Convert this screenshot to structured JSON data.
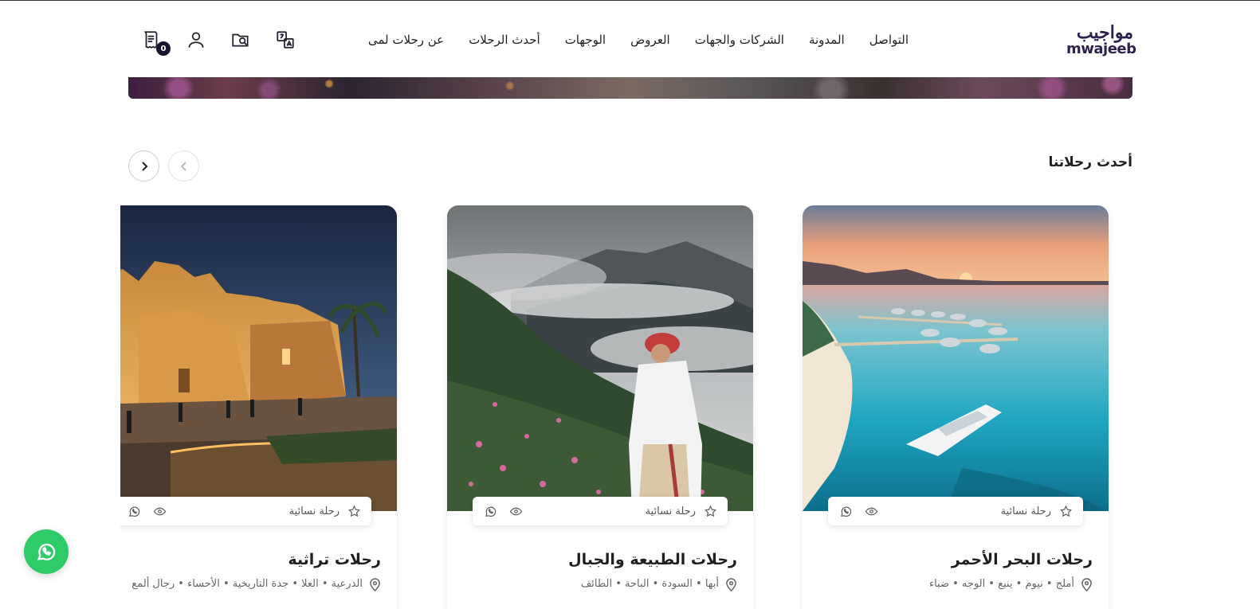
{
  "brand": {
    "name_ar": "مواجيب",
    "name_en": "mwajeeb"
  },
  "nav": {
    "items": [
      {
        "label": "عن رحلات لمى"
      },
      {
        "label": "أحدث الرحلات"
      },
      {
        "label": "الوجهات"
      },
      {
        "label": "العروض"
      },
      {
        "label": "الشركات والجهات"
      },
      {
        "label": "المدونة"
      },
      {
        "label": "التواصل"
      }
    ]
  },
  "header_icons": {
    "cart_count": "0",
    "icons": [
      "translate-icon",
      "search-icon",
      "user-icon",
      "cart-icon"
    ]
  },
  "section": {
    "title": "أحدث رحلاتنا"
  },
  "cards": [
    {
      "title": "رحلات البحر الأحمر",
      "tag": "رحلة نسائية",
      "locations": "أملج • نيوم • ينبع • الوجه • ضباء",
      "image": "red-sea-yacht"
    },
    {
      "title": "رحلات الطبيعة والجبال",
      "tag": "رحلة نسائية",
      "locations": "أبها • السودة • الباحة • الطائف",
      "image": "mountains-roses"
    },
    {
      "title": "رحلات تراثية",
      "tag": "رحلة نسائية",
      "locations": "الدرعية • العلا • جدة التاريخية • الأحساء • رجال ألمع",
      "image": "heritage-night"
    }
  ],
  "colors": {
    "brand": "#2d2150",
    "whatsapp": "#2ecc68",
    "badge": "#14142b"
  }
}
